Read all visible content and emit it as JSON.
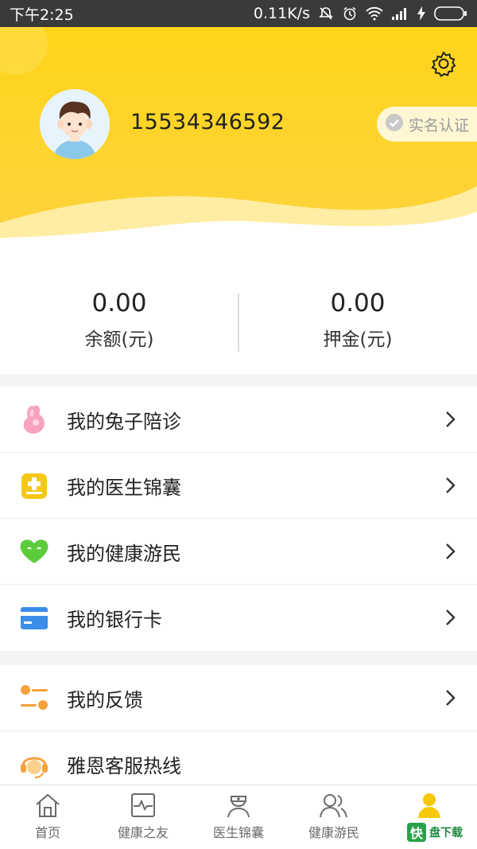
{
  "status_bar": {
    "time": "下午2:25",
    "network_speed": "0.11K/s",
    "icons": [
      "mute-icon",
      "alarm-icon",
      "wifi-icon",
      "signal-icon",
      "charging-icon",
      "battery-icon"
    ]
  },
  "profile": {
    "phone": "15534346592",
    "verify_label": "实名认证",
    "settings_icon": "gear-icon",
    "avatar": "avatar-boy"
  },
  "balance": {
    "amount_value": "0.00",
    "amount_label": "余额(元)",
    "deposit_value": "0.00",
    "deposit_label": "押金(元)"
  },
  "menu_group1": [
    {
      "label": "我的兔子陪诊",
      "icon": "rabbit-icon"
    },
    {
      "label": "我的医生锦囊",
      "icon": "medical-kit-icon"
    },
    {
      "label": "我的健康游民",
      "icon": "heart-icon"
    },
    {
      "label": "我的银行卡",
      "icon": "bank-card-icon"
    }
  ],
  "menu_group2": [
    {
      "label": "我的反馈",
      "icon": "feedback-icon"
    },
    {
      "label": "雅恩客服热线",
      "icon": "customer-service-icon"
    }
  ],
  "tabs": [
    {
      "label": "首页",
      "icon": "home-icon"
    },
    {
      "label": "健康之友",
      "icon": "health-monitor-icon"
    },
    {
      "label": "医生锦囊",
      "icon": "doctor-icon"
    },
    {
      "label": "健康游民",
      "icon": "group-icon"
    },
    {
      "label": "",
      "icon": "profile-icon",
      "active": true
    }
  ],
  "watermark": {
    "logo": "快",
    "text": "盘下载"
  },
  "colors": {
    "brand_yellow": "#fed41a",
    "tab_active": "#f5c90a",
    "tab_inactive": "#6a6a6a"
  }
}
